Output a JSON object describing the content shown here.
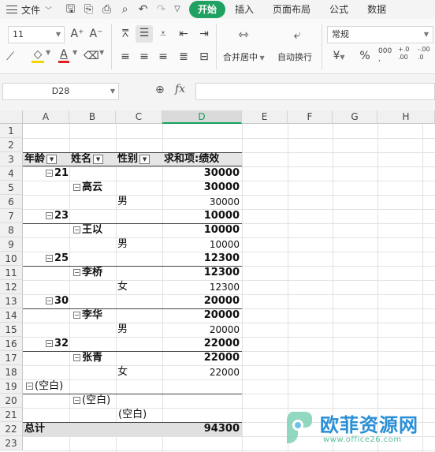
{
  "menu": {
    "file_label": "文件",
    "tabs": [
      "开始",
      "插入",
      "页面布局",
      "公式",
      "数据"
    ]
  },
  "ribbon": {
    "font_size": "11",
    "merge_label": "合并居中",
    "wrap_label": "自动换行",
    "number_format": "常规",
    "currency_symbol": "¥",
    "percent_symbol": "%",
    "thousands_symbol": "000",
    "decimal_inc": "+.0\n.00",
    "decimal_dec": "-.00\n.0"
  },
  "formula_bar": {
    "name_box": "D28",
    "fx": "fx"
  },
  "grid": {
    "columns": [
      "A",
      "B",
      "C",
      "D",
      "E",
      "F",
      "G",
      "H"
    ],
    "rows": [
      "1",
      "2",
      "3",
      "4",
      "5",
      "6",
      "7",
      "8",
      "9",
      "10",
      "11",
      "12",
      "13",
      "14",
      "15",
      "16",
      "17",
      "18",
      "19",
      "20",
      "21",
      "22",
      "23"
    ],
    "active_column": "D"
  },
  "pivot": {
    "header": {
      "age": "年龄",
      "name": "姓名",
      "gender": "性别",
      "sum": "求和项:绩效"
    },
    "groups": [
      {
        "age": "21",
        "age_total": "30000",
        "name": "高云",
        "name_total": "30000",
        "gender": "男",
        "value": "30000"
      },
      {
        "age": "23",
        "age_total": "10000",
        "name": "王以",
        "name_total": "10000",
        "gender": "男",
        "value": "10000"
      },
      {
        "age": "25",
        "age_total": "12300",
        "name": "李桥",
        "name_total": "12300",
        "gender": "女",
        "value": "12300"
      },
      {
        "age": "30",
        "age_total": "20000",
        "name": "李华",
        "name_total": "20000",
        "gender": "男",
        "value": "20000"
      },
      {
        "age": "32",
        "age_total": "22000",
        "name": "张青",
        "name_total": "22000",
        "gender": "女",
        "value": "22000"
      }
    ],
    "blank": {
      "age": "(空白)",
      "name": "(空白)",
      "gender": "(空白)"
    },
    "total_label": "总计",
    "total_value": "94300"
  },
  "watermark": {
    "title": "欧菲资源网",
    "url": "www.office26.com"
  }
}
